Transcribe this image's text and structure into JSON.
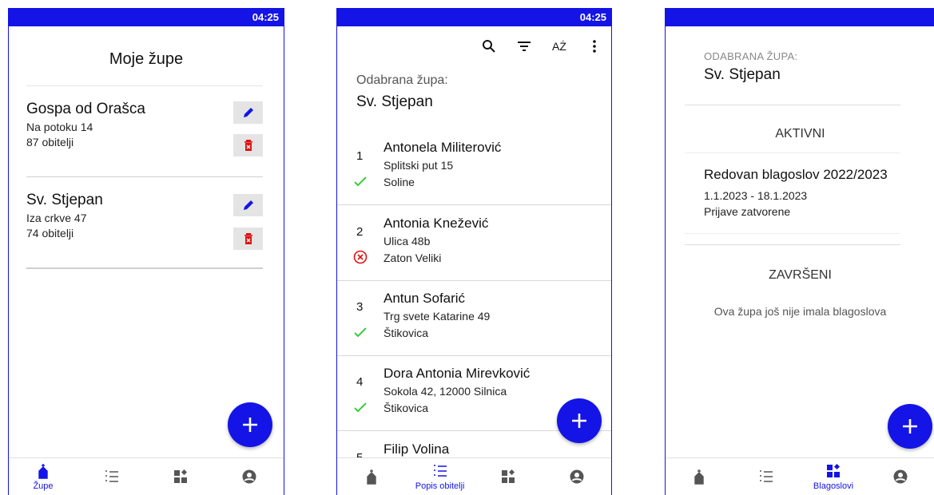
{
  "status_time": "04:25",
  "colors": {
    "accent": "#1414e6",
    "check": "#22cc22",
    "error": "#e01010",
    "delete_icon": "#e01010"
  },
  "screen1": {
    "title": "Moje župe",
    "parishes": [
      {
        "name": "Gospa od Orašca",
        "address": "Na potoku 14",
        "families": "87 obitelji",
        "edit_icon": "pencil-icon",
        "delete_icon": "trash-icon"
      },
      {
        "name": "Sv. Stjepan",
        "address": "Iza crkve 47",
        "families": "74 obitelji",
        "edit_icon": "pencil-icon",
        "delete_icon": "trash-icon"
      }
    ]
  },
  "screen2": {
    "toolbar_icons": [
      "search-icon",
      "filter-icon",
      "sort-az-icon",
      "more-icon"
    ],
    "sort_label": "AŻ",
    "selected_label": "Odabrana župa:",
    "selected_value": "Sv. Stjepan",
    "families": [
      {
        "num": "1",
        "name": "Antonela Militerović",
        "address": "Splitski put 15",
        "place": "Soline",
        "status": "done"
      },
      {
        "num": "2",
        "name": "Antonia Knežević",
        "address": "Ulica 48b",
        "place": "Zaton Veliki",
        "status": "rejected"
      },
      {
        "num": "3",
        "name": "Antun Sofarić",
        "address": "Trg svete Katarine 49",
        "place": "Štikovica",
        "status": "done"
      },
      {
        "num": "4",
        "name": "Dora Antonia Mirevković",
        "address": "Sokola 42, 12000 Silnica",
        "place": "Štikovica",
        "status": "done"
      },
      {
        "num": "5",
        "name": "Filip Volina",
        "address": "",
        "place": "",
        "status": ""
      }
    ]
  },
  "screen3": {
    "selected_label": "ODABRANA ŽUPA:",
    "selected_value": "Sv. Stjepan",
    "active_heading": "AKTIVNI",
    "active": {
      "name": "Redovan blagoslov 2022/2023",
      "dates": "1.1.2023 - 18.1.2023",
      "status": "Prijave zatvorene"
    },
    "finished_heading": "ZAVRŠENI",
    "finished_empty": "Ova župa još nije imala blagoslova"
  },
  "nav": {
    "items": [
      {
        "icon": "church-icon",
        "label": "Župe"
      },
      {
        "icon": "list-icon",
        "label": "Popis obitelji"
      },
      {
        "icon": "blessing-icon",
        "label": "Blagoslovi"
      },
      {
        "icon": "account-icon",
        "label": ""
      }
    ]
  }
}
